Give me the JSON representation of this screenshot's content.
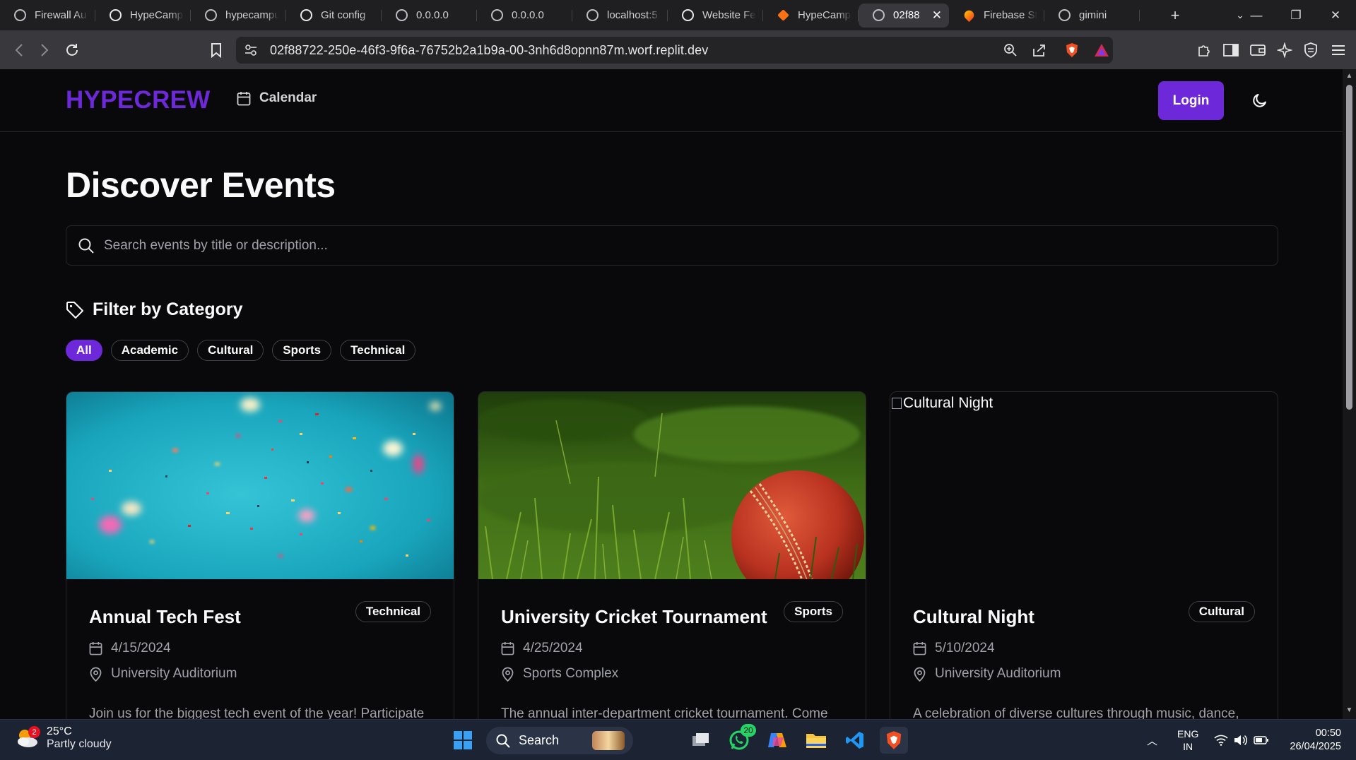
{
  "browser": {
    "tabs": [
      {
        "title": "Firewall Au",
        "favicon": "globe-icon"
      },
      {
        "title": "HypeCamp",
        "favicon": "chatgpt-icon"
      },
      {
        "title": "hypecampus",
        "favicon": "globe-icon"
      },
      {
        "title": "Git config",
        "favicon": "chatgpt-icon"
      },
      {
        "title": "0.0.0.0",
        "favicon": "globe-icon"
      },
      {
        "title": "0.0.0.0",
        "favicon": "globe-icon"
      },
      {
        "title": "localhost:5",
        "favicon": "globe-icon"
      },
      {
        "title": "Website Fe",
        "favicon": "chatgpt-icon"
      },
      {
        "title": "HypeCamp",
        "favicon": "replit-icon"
      },
      {
        "title": "02f88",
        "favicon": "globe-icon",
        "active": true
      },
      {
        "title": "Firebase St",
        "favicon": "firebase-icon"
      },
      {
        "title": "gimini",
        "favicon": "globe-icon"
      }
    ],
    "new_tab": "+",
    "url": "02f88722-250e-46f3-9f6a-76752b2a1b9a-00-3nh6d8opnn87m.worf.replit.dev"
  },
  "nav": {
    "logo": "HYPECREW",
    "calendar_label": "Calendar",
    "login_label": "Login"
  },
  "main": {
    "heading": "Discover Events",
    "search_placeholder": "Search events by title or description...",
    "filter_title": "Filter by Category",
    "categories": [
      "All",
      "Academic",
      "Cultural",
      "Sports",
      "Technical"
    ],
    "selected_category": "All"
  },
  "events": [
    {
      "title": "Annual Tech Fest",
      "category": "Technical",
      "date": "4/15/2024",
      "location": "University Auditorium",
      "description": "Join us for the biggest tech event of the year! Participate",
      "image": "confetti"
    },
    {
      "title": "University Cricket Tournament",
      "category": "Sports",
      "date": "4/25/2024",
      "location": "Sports Complex",
      "description": "The annual inter-department cricket tournament. Come",
      "image": "cricket-ball"
    },
    {
      "title": "Cultural Night",
      "category": "Cultural",
      "date": "5/10/2024",
      "location": "University Auditorium",
      "description": "A celebration of diverse cultures through music, dance,",
      "image_alt": "Cultural Night"
    }
  ],
  "taskbar": {
    "weather_temp": "25°C",
    "weather_cond": "Partly cloudy",
    "weather_badge": "2",
    "search_label": "Search",
    "whatsapp_badge": "20",
    "lang_1": "ENG",
    "lang_2": "IN",
    "time": "00:50",
    "date": "26/04/2025"
  },
  "colors": {
    "accent": "#6d28d9",
    "background": "#09090b",
    "border": "#27272a",
    "muted_text": "#a1a1aa"
  }
}
